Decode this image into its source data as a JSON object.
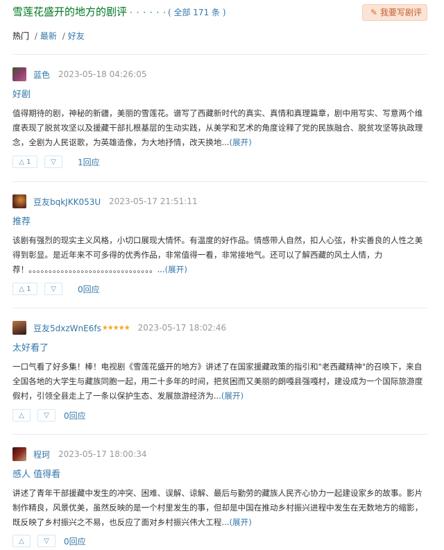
{
  "header": {
    "title": "雪莲花盛开的地方的剧评",
    "dots": "· · · · · ·",
    "count": "( 全部 171 条 )",
    "write_button": "我要写剧评",
    "write_icon": "pencil-icon"
  },
  "filters": {
    "hot": "热门",
    "sep1": "/",
    "latest": "最新",
    "sep2": "/",
    "friends": "好友"
  },
  "reviews": [
    {
      "user": "蓝色",
      "stars": "",
      "time": "2023-05-18 04:26:05",
      "title": "好剧",
      "body": "值得期待的剧，神秘的新疆，美丽的雪莲花。谱写了西藏新时代的真实、真情和真理篇章，剧中用写实、写意两个维度表现了脱贫攻坚以及援藏干部扎根基层的生动实践，从美学和艺术的角度诠释了党的民族融合、脱贫攻坚等执政理念，全剧为人民讴歌，为英雄造像，为大地抒情，改天换地...",
      "more": "(展开)",
      "up": "1",
      "replies": "1回应",
      "avatar_color": "#7a4b6b"
    },
    {
      "user": "豆友bqkJKK053U",
      "stars": "",
      "time": "2023-05-17 21:51:11",
      "title": "推荐",
      "body": "该剧有强烈的现实主义风格，小切口展现大情怀。有温度的好作品。情感带人自然，扣人心弦，朴实善良的人性之美得到彰显。是近年来不可多得的优秀作品，非常值得一看，非常接地气。还可以了解西藏的风土人情，力荐！。。。。。。。。。。。。。。。。。。。。。。。。。。。。。。。...",
      "more": "(展开)",
      "up": "1",
      "replies": "0回应",
      "avatar_color": "#5a2a1a"
    },
    {
      "user": "豆友5dxzWnE6fs",
      "stars": "★★★★★",
      "time": "2023-05-17 18:02:46",
      "title": "太好看了",
      "body": "一口气看了好多集！棒！电视剧《雪莲花盛开的地方》讲述了在国家援藏政策的指引和\"老西藏精神\"的召唤下，来自全国各地的大学生与藏族同胞一起，用二十多年的时间，把贫困而又美丽的朗嘎县强嘎村，建设成为一个国际旅游度假村，引领全县走上了一条以保护生态、发展旅游经济为...",
      "more": "(展开)",
      "up": "",
      "replies": "0回应",
      "avatar_color": "#8a5a3a"
    },
    {
      "user": "程珂",
      "stars": "",
      "time": "2023-05-17 18:00:34",
      "title": "感人 值得看",
      "body": "讲述了青年干部援藏中发生的冲突、困难、误解、谅解、最后与勤劳的藏族人民齐心协力一起建设家乡的故事。影片制作精良，风景优美，虽然反映的是一个村里发生的事，但却是中国在推动乡村振兴进程中发生在无数地方的缩影，既反映了乡村振兴之不易，也反应了面对乡村振兴伟大工程...",
      "more": "(展开)",
      "up": "",
      "replies": "0回应",
      "avatar_color": "#6a1e1e"
    }
  ],
  "icons": {
    "up": "△",
    "down": "▽"
  }
}
